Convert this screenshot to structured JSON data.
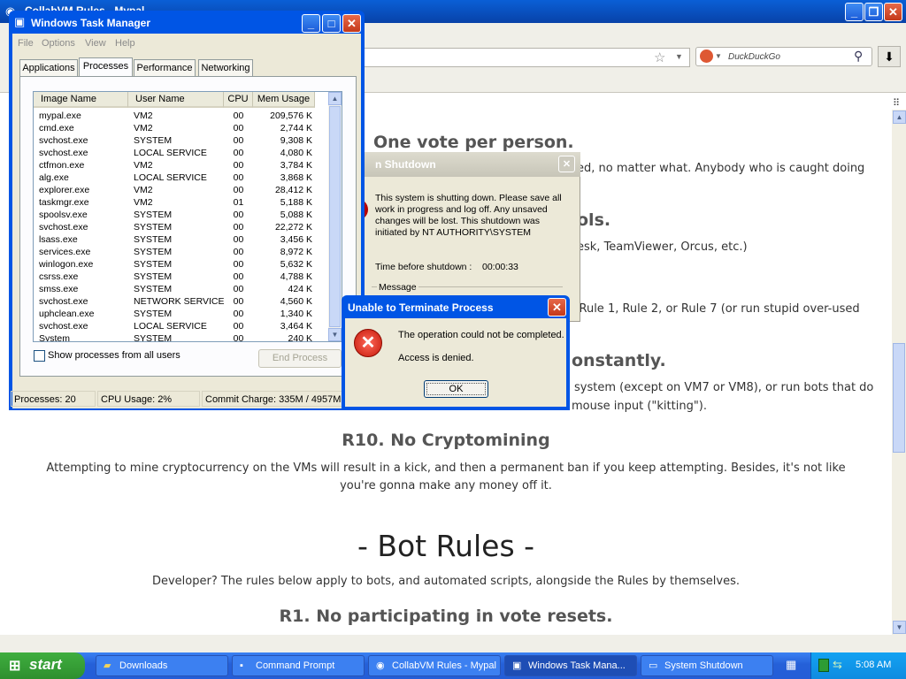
{
  "browser": {
    "title": "CollabVM Rules - Mypal",
    "search_placeholder": "DuckDuckGo"
  },
  "page": {
    "heading_vote": "One vote per person.",
    "text_vote": "ed, no matter what. Anybody who is caught doing",
    "heading_tools": "ols.",
    "text_tools": "esk, TeamViewer, Orcus, etc.)",
    "text_rules": ": Rule 1, Rule 2, or Rule 7 (or run stupid over-used",
    "heading_constantly": "onstantly.",
    "text_system": "system (except on VM7 or VM8), or run bots that do",
    "text_mouse": "mouse input (\"kitting\").",
    "heading_r10": "R10. No Cryptomining",
    "text_r10": "Attempting to mine cryptocurrency on the VMs will result in a kick, and then a permanent ban if you keep attempting. Besides, it's not like you're gonna make any money off it.",
    "heading_bot": "- Bot Rules -",
    "text_bot": "Developer? The rules below apply to bots, and automated scripts, alongside the Rules by themselves.",
    "heading_r1": "R1. No participating in vote resets."
  },
  "taskmgr": {
    "title": "Windows Task Manager",
    "menu": [
      "File",
      "Options",
      "View",
      "Help"
    ],
    "tabs": [
      "Applications",
      "Processes",
      "Performance",
      "Networking"
    ],
    "columns": [
      "Image Name",
      "User Name",
      "CPU",
      "Mem Usage"
    ],
    "processes": [
      [
        "mypal.exe",
        "VM2",
        "00",
        "209,576 K"
      ],
      [
        "cmd.exe",
        "VM2",
        "00",
        "2,744 K"
      ],
      [
        "svchost.exe",
        "SYSTEM",
        "00",
        "9,308 K"
      ],
      [
        "svchost.exe",
        "LOCAL SERVICE",
        "00",
        "4,080 K"
      ],
      [
        "ctfmon.exe",
        "VM2",
        "00",
        "3,784 K"
      ],
      [
        "alg.exe",
        "LOCAL SERVICE",
        "00",
        "3,868 K"
      ],
      [
        "explorer.exe",
        "VM2",
        "00",
        "28,412 K"
      ],
      [
        "taskmgr.exe",
        "VM2",
        "01",
        "5,188 K"
      ],
      [
        "spoolsv.exe",
        "SYSTEM",
        "00",
        "5,088 K"
      ],
      [
        "svchost.exe",
        "SYSTEM",
        "00",
        "22,272 K"
      ],
      [
        "lsass.exe",
        "SYSTEM",
        "00",
        "3,456 K"
      ],
      [
        "services.exe",
        "SYSTEM",
        "00",
        "8,972 K"
      ],
      [
        "winlogon.exe",
        "SYSTEM",
        "00",
        "5,632 K"
      ],
      [
        "csrss.exe",
        "SYSTEM",
        "00",
        "4,788 K"
      ],
      [
        "smss.exe",
        "SYSTEM",
        "00",
        "424 K"
      ],
      [
        "svchost.exe",
        "NETWORK SERVICE",
        "00",
        "4,560 K"
      ],
      [
        "uphclean.exe",
        "SYSTEM",
        "00",
        "1,340 K"
      ],
      [
        "svchost.exe",
        "LOCAL SERVICE",
        "00",
        "3,464 K"
      ],
      [
        "System",
        "SYSTEM",
        "00",
        "240 K"
      ]
    ],
    "show_all_label": "Show processes from all users",
    "end_process_label": "End Process",
    "status_processes": "Processes: 20",
    "status_cpu": "CPU Usage: 2%",
    "status_commit": "Commit Charge: 335M / 4957M"
  },
  "shutdown": {
    "title": "n Shutdown",
    "message": "This system is shutting down. Please save all work in progress and log off. Any unsaved changes will be lost. This shutdown was initiated by NT AUTHORITY\\SYSTEM",
    "time_label": "Time before shutdown :",
    "time_value": "00:00:33",
    "message_label": "Message"
  },
  "error": {
    "title": "Unable to Terminate Process",
    "line1": "The operation could not be completed.",
    "line2": "Access is denied.",
    "ok_label": "OK"
  },
  "taskbar": {
    "start_label": "start",
    "items": [
      "Downloads",
      "Command Prompt",
      "CollabVM Rules - Mypal",
      "Windows Task Mana...",
      "System Shutdown"
    ],
    "clock": "5:08 AM"
  }
}
